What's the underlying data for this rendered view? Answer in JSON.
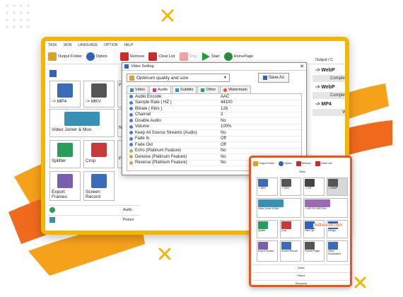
{
  "menu": [
    "TASK",
    "SKIN",
    "LANGUAGE",
    "OPTION",
    "HELP"
  ],
  "toolbar": [
    {
      "label": "Output Folder",
      "icon": "output-folder-icon",
      "color": "#d9a12a",
      "disabled": false
    },
    {
      "label": "Option",
      "icon": "option-icon",
      "color": "#2f62b8",
      "disabled": false
    },
    {
      "label": "Remove",
      "icon": "remove-icon",
      "color": "#cc2b2b",
      "disabled": false
    },
    {
      "label": "Clear List",
      "icon": "clear-list-icon",
      "color": "#cc2b2b",
      "disabled": false
    },
    {
      "label": "Stop",
      "icon": "stop-icon",
      "color": "#f1a3a3",
      "disabled": true
    },
    {
      "label": "Start",
      "icon": "start-icon",
      "color": "#1aa23b",
      "disabled": false
    },
    {
      "label": "HomePage",
      "icon": "homepage-icon",
      "color": "#2c8c3c",
      "disabled": false
    }
  ],
  "left": {
    "video_label": "Video",
    "tiles": [
      "-> MP4",
      "-> MKV",
      "Video Joiner & Mux",
      "Splitter",
      "Crop",
      "Export Frames",
      "Screen Record",
      "Fa",
      "Fa",
      "N"
    ],
    "categories": [
      "Audio",
      "Picture"
    ]
  },
  "right": {
    "header": "Output / C",
    "rows": [
      {
        "title": "-> WebP",
        "status": "Completed"
      },
      {
        "title": "-> WebP",
        "status": "Completed"
      },
      {
        "title": "-> MP4",
        "status": "Wait"
      }
    ]
  },
  "dialog": {
    "title": "Video Setting",
    "close": "✕",
    "preset": "Optimum quality and size",
    "save_as": "Save As",
    "tabs": [
      "Video",
      "Audio",
      "Subtitle",
      "Other",
      "Watermark"
    ],
    "active_tab": "Audio",
    "props": [
      [
        "Audio Encode",
        "AAC"
      ],
      [
        "Sample Rate ( HZ )",
        "44100"
      ],
      [
        "Bitrate ( Kb/s )",
        "128"
      ],
      [
        "Channel",
        "2"
      ],
      [
        "Disable Audio",
        "No"
      ],
      [
        "Volume",
        "100%"
      ],
      [
        "Keep All Source Streams (Audio)",
        "No"
      ],
      [
        "Fade In",
        "Off"
      ],
      [
        "Fade Out",
        "Off"
      ],
      [
        "Echo (Platinum Feature)",
        "No"
      ],
      [
        "Denoise (Platinum Feature)",
        "No"
      ],
      [
        "Reverse (Platinum Feature)",
        "No"
      ]
    ]
  },
  "second": {
    "toolbar": [
      "Output Folder",
      "Option",
      "Remove",
      "Clear List"
    ],
    "video_label": "Video",
    "tiles": [
      "-> MP4",
      "-> MKV",
      "-> GIF",
      "-> WebP",
      "Video Joiner & Mux",
      "-> API FLV MP3 Etc...",
      "Splitter",
      "Crop",
      "Fast Clip",
      "Delogo",
      "Export Frames",
      "Screen Record",
      "Format Player",
      "Video Downloader"
    ],
    "categories": [
      "Audio",
      "Picture",
      "Document"
    ]
  },
  "watermark": "Softwarert.com"
}
